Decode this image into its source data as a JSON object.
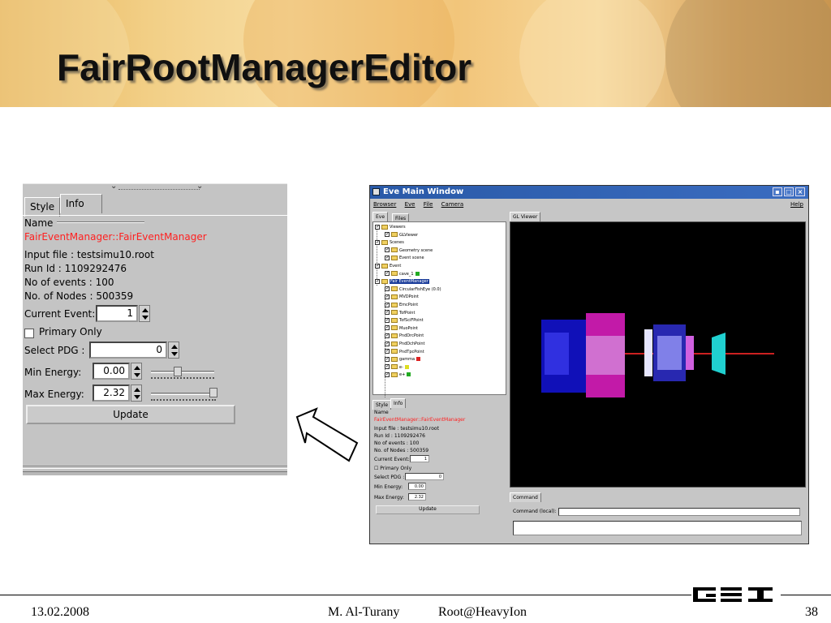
{
  "slide": {
    "title": "FairRootManagerEditor",
    "footer": {
      "date": "13.02.2008",
      "author": "M. Al-Turany",
      "event": "Root@HeavyIon",
      "page": "38",
      "logo": "GSI"
    }
  },
  "editor_large": {
    "tabs": [
      "Style",
      "Info"
    ],
    "active_tab": "Info",
    "name_label": "Name",
    "name_value": "FairEventManager::FairEventManager",
    "input_file": "Input file : testsimu10.root",
    "run_id": "Run Id : 1109292476",
    "no_events": "No of events : 100",
    "no_nodes": "No. of Nodes : 500359",
    "current_event_label": "Current Event:",
    "current_event_value": "1",
    "primary_only_label": "Primary Only",
    "primary_only_checked": false,
    "select_pdg_label": "Select PDG :",
    "select_pdg_value": "0",
    "min_energy_label": "Min Energy:",
    "min_energy_value": "0.00",
    "max_energy_label": "Max Energy:",
    "max_energy_value": "2.32",
    "update_label": "Update"
  },
  "eve_window": {
    "title": "Eve Main Window",
    "window_buttons": [
      "▪",
      "□",
      "×"
    ],
    "menu": [
      "Browser",
      "Eve",
      "File",
      "Camera"
    ],
    "help": "Help",
    "left_tabs": [
      "Eve",
      "Files"
    ],
    "viewer_tab": "GL Viewer",
    "tree": [
      {
        "label": "Viewers",
        "level": 0,
        "selected": false,
        "marker": ""
      },
      {
        "label": "GLViewer",
        "level": 1,
        "selected": false,
        "marker": ""
      },
      {
        "label": "Scenes",
        "level": 0,
        "selected": false,
        "marker": ""
      },
      {
        "label": "Geometry scene",
        "level": 1,
        "selected": false,
        "marker": ""
      },
      {
        "label": "Event scene",
        "level": 1,
        "selected": false,
        "marker": ""
      },
      {
        "label": "Event",
        "level": 0,
        "selected": false,
        "marker": ""
      },
      {
        "label": "cave_1",
        "level": 1,
        "selected": false,
        "marker": "#22aa22"
      },
      {
        "label": "Fair EventManager",
        "level": 0,
        "selected": true,
        "marker": ""
      },
      {
        "label": "CircularFishEye (0.0)",
        "level": 1,
        "selected": false,
        "marker": ""
      },
      {
        "label": "MVDPoint",
        "level": 1,
        "selected": false,
        "marker": ""
      },
      {
        "label": "EmcPoint",
        "level": 1,
        "selected": false,
        "marker": ""
      },
      {
        "label": "TofPoint",
        "level": 1,
        "selected": false,
        "marker": ""
      },
      {
        "label": "TofSciFPoint",
        "level": 1,
        "selected": false,
        "marker": ""
      },
      {
        "label": "MuoPoint",
        "level": 1,
        "selected": false,
        "marker": ""
      },
      {
        "label": "PndDrcPoint",
        "level": 1,
        "selected": false,
        "marker": ""
      },
      {
        "label": "PndDchPoint",
        "level": 1,
        "selected": false,
        "marker": ""
      },
      {
        "label": "PndTpcPoint",
        "level": 1,
        "selected": false,
        "marker": ""
      },
      {
        "label": "gamma",
        "level": 1,
        "selected": false,
        "marker": "#dd2222"
      },
      {
        "label": "e-",
        "level": 1,
        "selected": false,
        "marker": "#dddd22"
      },
      {
        "label": "e+",
        "level": 1,
        "selected": false,
        "marker": "#22aa22"
      }
    ],
    "small_editor": {
      "tabs": [
        "Style",
        "Info"
      ],
      "name_label": "Name",
      "name_value": "FairEventManager::FairEventManager",
      "input_file": "Input file : testsimu10.root",
      "run_id": "Run Id : 1109292476",
      "no_events": "No of events : 100",
      "no_nodes": "No. of Nodes : 500359",
      "current_event_label": "Current Event:",
      "current_event_value": "1",
      "primary_only_label": "Primary Only",
      "select_pdg_label": "Select PDG :",
      "select_pdg_value": "0",
      "min_energy_label": "Min Energy:",
      "min_energy_value": "0.00",
      "max_energy_label": "Max Energy:",
      "max_energy_value": "2.32",
      "update_label": "Update"
    },
    "command_tab": "Command",
    "command_label": "Command (local):"
  }
}
